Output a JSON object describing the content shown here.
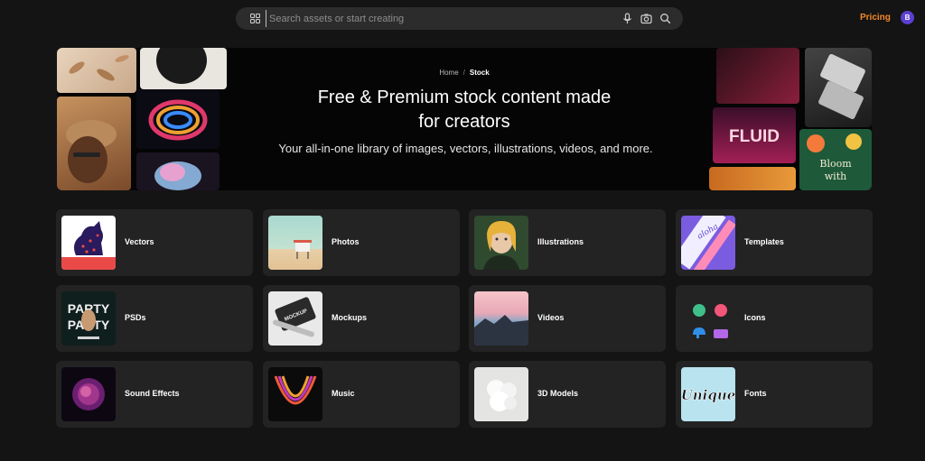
{
  "search": {
    "placeholder": "Search assets or start creating"
  },
  "header": {
    "pricing_label": "Pricing",
    "avatar_initial": "B"
  },
  "hero": {
    "breadcrumb": {
      "home": "Home",
      "separator": "/",
      "current": "Stock"
    },
    "title_line1": "Free & Premium stock content made",
    "title_line2": "for creators",
    "subtitle": "Your all-in-one library of images, vectors, illustrations, videos, and more.",
    "collage_text": {
      "fluid": "FLUID",
      "bloom": "Bloom\nwith"
    }
  },
  "categories": [
    {
      "label": "Vectors"
    },
    {
      "label": "Photos"
    },
    {
      "label": "Illustrations"
    },
    {
      "label": "Templates"
    },
    {
      "label": "PSDs"
    },
    {
      "label": "Mockups"
    },
    {
      "label": "Videos"
    },
    {
      "label": "Icons"
    },
    {
      "label": "Sound Effects"
    },
    {
      "label": "Music"
    },
    {
      "label": "3D Models"
    },
    {
      "label": "Fonts"
    }
  ],
  "thumb_text": {
    "psd_word": "PARTY",
    "mockup_word": "MOCKUP",
    "template_word": "aloha",
    "fonts_word": "Unique"
  },
  "colors": {
    "accent": "#f5872a",
    "avatar": "#5b3fd1",
    "card_bg": "#232323",
    "page_bg": "#141414"
  }
}
